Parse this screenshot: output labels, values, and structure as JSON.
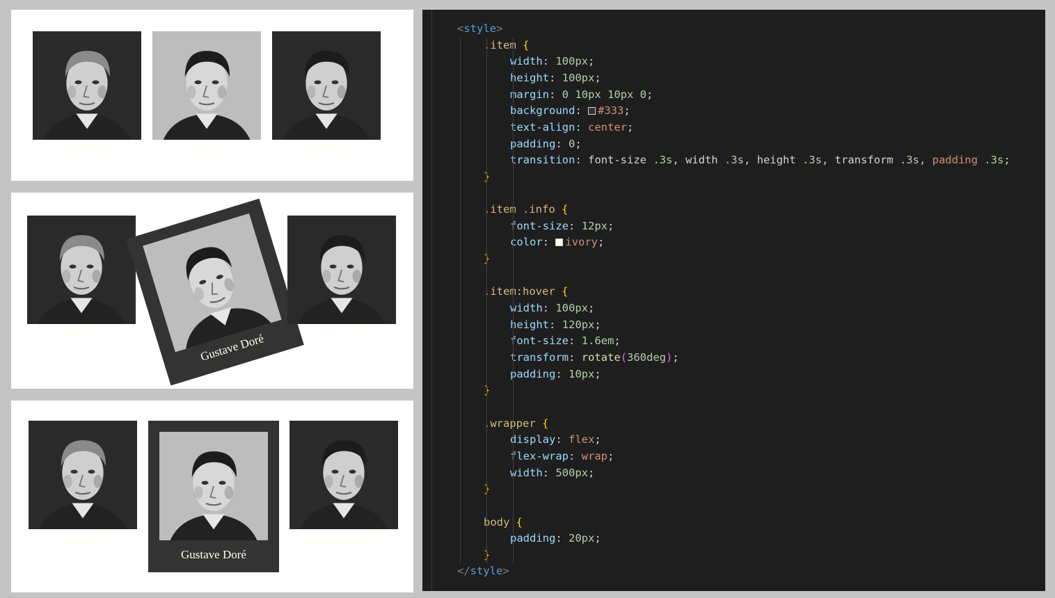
{
  "gallery": {
    "people": [
      {
        "name": "Benjamin Rush",
        "hue": "dark"
      },
      {
        "name": "Gustave Doré",
        "hue": "mid"
      },
      {
        "name": "Jacques-Louis David",
        "hue": "dark"
      }
    ],
    "hover_caption": "Gustave Doré"
  },
  "code": {
    "lines": [
      [
        [
          "tok-bracket",
          "<"
        ],
        [
          "tok-tag",
          "style"
        ],
        [
          "tok-bracket",
          ">"
        ]
      ],
      [
        [
          "tok-sel",
          ".item "
        ],
        [
          "tok-brace",
          "{"
        ]
      ],
      [
        [
          "tok-prop",
          "width"
        ],
        [
          "tok-punc",
          ": "
        ],
        [
          "tok-num",
          "100px"
        ],
        [
          "tok-punc",
          ";"
        ]
      ],
      [
        [
          "tok-prop",
          "height"
        ],
        [
          "tok-punc",
          ": "
        ],
        [
          "tok-num",
          "100px"
        ],
        [
          "tok-punc",
          ";"
        ]
      ],
      [
        [
          "tok-prop",
          "margin"
        ],
        [
          "tok-punc",
          ": "
        ],
        [
          "tok-num",
          "0 10px 10px 0"
        ],
        [
          "tok-punc",
          ";"
        ]
      ],
      [
        [
          "tok-prop",
          "background"
        ],
        [
          "tok-punc",
          ": "
        ],
        [
          "swatch",
          "#333333"
        ],
        [
          "tok-kw",
          "#333"
        ],
        [
          "tok-punc",
          ";"
        ]
      ],
      [
        [
          "tok-prop",
          "text-align"
        ],
        [
          "tok-punc",
          ": "
        ],
        [
          "tok-kw",
          "center"
        ],
        [
          "tok-punc",
          ";"
        ]
      ],
      [
        [
          "tok-prop",
          "padding"
        ],
        [
          "tok-punc",
          ": "
        ],
        [
          "tok-num",
          "0"
        ],
        [
          "tok-punc",
          ";"
        ]
      ],
      [
        [
          "tok-prop",
          "transition"
        ],
        [
          "tok-punc",
          ": font-size "
        ],
        [
          "tok-num",
          ".3s"
        ],
        [
          "tok-punc",
          ", width "
        ],
        [
          "tok-num",
          ".3s"
        ],
        [
          "tok-punc",
          ", height "
        ],
        [
          "tok-num",
          ".3s"
        ],
        [
          "tok-punc",
          ", transform "
        ],
        [
          "tok-num",
          ".3s"
        ],
        [
          "tok-punc",
          ", "
        ],
        [
          "tok-err",
          "padding"
        ],
        [
          "tok-punc",
          " "
        ],
        [
          "tok-num",
          ".3s"
        ],
        [
          "tok-punc",
          ";"
        ]
      ],
      [
        [
          "tok-brace",
          "}"
        ]
      ],
      [],
      [
        [
          "tok-sel",
          ".item .info "
        ],
        [
          "tok-brace",
          "{"
        ]
      ],
      [
        [
          "tok-prop",
          "font-size"
        ],
        [
          "tok-punc",
          ": "
        ],
        [
          "tok-num",
          "12px"
        ],
        [
          "tok-punc",
          ";"
        ]
      ],
      [
        [
          "tok-prop",
          "color"
        ],
        [
          "tok-punc",
          ": "
        ],
        [
          "swatch",
          "#fffff0"
        ],
        [
          "tok-kw",
          "ivory"
        ],
        [
          "tok-punc",
          ";"
        ]
      ],
      [
        [
          "tok-brace",
          "}"
        ]
      ],
      [],
      [
        [
          "tok-sel",
          ".item:hover "
        ],
        [
          "tok-brace",
          "{"
        ]
      ],
      [
        [
          "tok-prop",
          "width"
        ],
        [
          "tok-punc",
          ": "
        ],
        [
          "tok-num",
          "100px"
        ],
        [
          "tok-punc",
          ";"
        ]
      ],
      [
        [
          "tok-prop",
          "height"
        ],
        [
          "tok-punc",
          ": "
        ],
        [
          "tok-num",
          "120px"
        ],
        [
          "tok-punc",
          ";"
        ]
      ],
      [
        [
          "tok-prop",
          "font-size"
        ],
        [
          "tok-punc",
          ": "
        ],
        [
          "tok-num",
          "1.6em"
        ],
        [
          "tok-punc",
          ";"
        ]
      ],
      [
        [
          "tok-prop",
          "transform"
        ],
        [
          "tok-punc",
          ": "
        ],
        [
          "tok-fn",
          "rotate"
        ],
        [
          "tok-paren",
          "("
        ],
        [
          "tok-num",
          "360deg"
        ],
        [
          "tok-paren",
          ")"
        ],
        [
          "tok-punc",
          ";"
        ]
      ],
      [
        [
          "tok-prop",
          "padding"
        ],
        [
          "tok-punc",
          ": "
        ],
        [
          "tok-num",
          "10px"
        ],
        [
          "tok-punc",
          ";"
        ]
      ],
      [
        [
          "tok-brace",
          "}"
        ]
      ],
      [],
      [
        [
          "tok-sel",
          ".wrapper "
        ],
        [
          "tok-brace",
          "{"
        ]
      ],
      [
        [
          "tok-prop",
          "display"
        ],
        [
          "tok-punc",
          ": "
        ],
        [
          "tok-kw",
          "flex"
        ],
        [
          "tok-punc",
          ";"
        ]
      ],
      [
        [
          "tok-prop",
          "flex-wrap"
        ],
        [
          "tok-punc",
          ": "
        ],
        [
          "tok-kw",
          "wrap"
        ],
        [
          "tok-punc",
          ";"
        ]
      ],
      [
        [
          "tok-prop",
          "width"
        ],
        [
          "tok-punc",
          ": "
        ],
        [
          "tok-num",
          "500px"
        ],
        [
          "tok-punc",
          ";"
        ]
      ],
      [
        [
          "tok-brace",
          "}"
        ]
      ],
      [],
      [
        [
          "tok-sel",
          "body "
        ],
        [
          "tok-brace",
          "{"
        ]
      ],
      [
        [
          "tok-prop",
          "padding"
        ],
        [
          "tok-punc",
          ": "
        ],
        [
          "tok-num",
          "20px"
        ],
        [
          "tok-punc",
          ";"
        ]
      ],
      [
        [
          "tok-brace",
          "}"
        ]
      ],
      [
        [
          "tok-bracket",
          "</"
        ],
        [
          "tok-tag",
          "style"
        ],
        [
          "tok-bracket",
          ">"
        ]
      ]
    ],
    "indents": [
      0,
      1,
      2,
      2,
      2,
      2,
      2,
      2,
      2,
      1,
      0,
      1,
      2,
      2,
      1,
      0,
      1,
      2,
      2,
      2,
      2,
      2,
      1,
      0,
      1,
      2,
      2,
      2,
      1,
      0,
      1,
      2,
      1,
      0
    ]
  },
  "colors": {
    "page_bg": "#c4c4c4",
    "panel_bg": "#ffffff",
    "editor_bg": "#1e1e1e",
    "card_bg": "#333333",
    "caption": "#fffff0"
  }
}
